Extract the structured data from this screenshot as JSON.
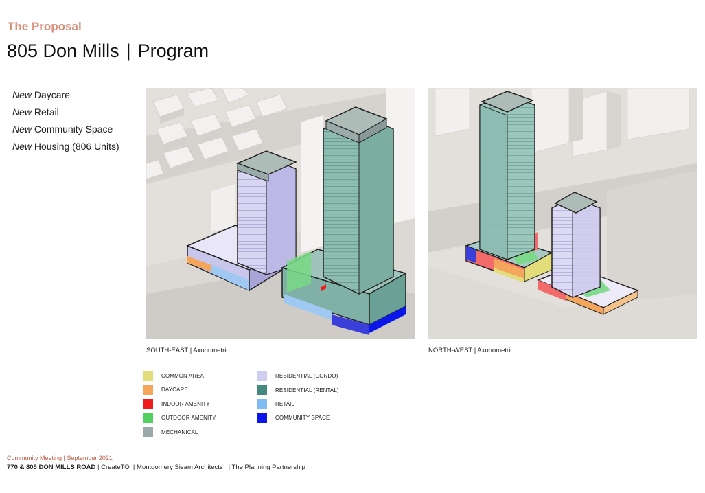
{
  "header": {
    "eyebrow": "The Proposal",
    "title_left": "805 Don Mills",
    "title_sep": "|",
    "title_right": "Program"
  },
  "program": [
    {
      "prefix": "New",
      "text": "Daycare"
    },
    {
      "prefix": "New",
      "text": "Retail"
    },
    {
      "prefix": "New",
      "text": "Community Space"
    },
    {
      "prefix": "New",
      "text": "Housing (806 Units)"
    }
  ],
  "views": {
    "south_east": {
      "direction": "SOUTH-EAST",
      "sep": "|",
      "type": "Axonometric"
    },
    "north_west": {
      "direction": "NORTH-WEST",
      "sep": "|",
      "type": "Axonometric"
    }
  },
  "legend": [
    {
      "label": "COMMON AREA",
      "color": "#e3dc7a"
    },
    {
      "label": "DAYCARE",
      "color": "#f4a65d"
    },
    {
      "label": "INDOOR AMENITY",
      "color": "#f01c1c"
    },
    {
      "label": "OUTDOOR AMENITY",
      "color": "#4fd05f"
    },
    {
      "label": "MECHANICAL",
      "color": "#9aaaa8"
    },
    {
      "label": "RESIDENTIAL (CONDO)",
      "color": "#cfcdf2"
    },
    {
      "label": "RESIDENTIAL (RENTAL)",
      "color": "#44897f"
    },
    {
      "label": "RETAIL",
      "color": "#7fbcf2"
    },
    {
      "label": "COMMUNITY SPACE",
      "color": "#0b16e8"
    }
  ],
  "footer": {
    "meeting": "Community Meeting | September 2021",
    "address": "770 & 805 DON MILLS ROAD",
    "sep1": "|",
    "org1": "CreateTO",
    "sep2": "|",
    "org2": "Montgomery Sisam Architects",
    "sep3": "|",
    "org3": "The Planning Partnership"
  }
}
